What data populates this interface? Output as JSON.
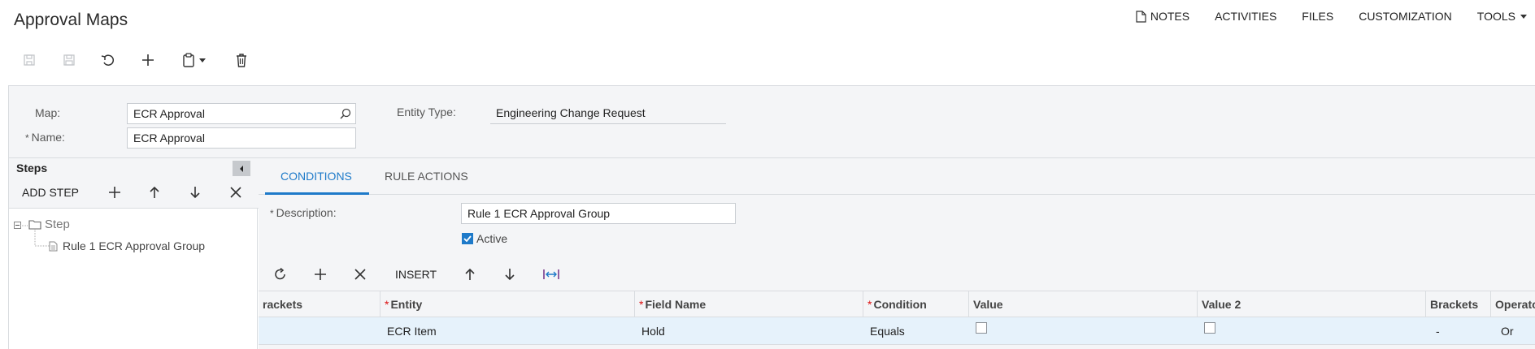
{
  "page": {
    "title": "Approval Maps"
  },
  "top_menu": {
    "notes": "NOTES",
    "activities": "ACTIVITIES",
    "files": "FILES",
    "customization": "CUSTOMIZATION",
    "tools": "TOOLS"
  },
  "form": {
    "map_label": "Map:",
    "map_value": "ECR Approval",
    "name_label": "Name:",
    "name_value": "ECR Approval",
    "entity_type_label": "Entity Type:",
    "entity_type_value": "Engineering Change Request",
    "required_mark": "*"
  },
  "steps": {
    "title": "Steps",
    "add_step_label": "ADD STEP",
    "tree": {
      "root_label": "Step",
      "child_label": "Rule 1 ECR Approval Group"
    }
  },
  "tabs": [
    {
      "label": "CONDITIONS",
      "active": true
    },
    {
      "label": "RULE ACTIONS",
      "active": false
    }
  ],
  "conditions": {
    "description_label": "Description:",
    "description_value": "Rule 1 ECR Approval Group",
    "active_label": "Active",
    "active_checked": true
  },
  "grid": {
    "insert_label": "INSERT",
    "columns": [
      {
        "label": "rackets",
        "required": false
      },
      {
        "label": "Entity",
        "required": true
      },
      {
        "label": "Field Name",
        "required": true
      },
      {
        "label": "Condition",
        "required": true
      },
      {
        "label": "Value",
        "required": false
      },
      {
        "label": "Value 2",
        "required": false
      },
      {
        "label": "Brackets",
        "required": false
      },
      {
        "label": "Operato",
        "required": false
      }
    ],
    "rows": [
      {
        "brackets_open": "",
        "entity": "ECR Item",
        "field_name": "Hold",
        "condition": "Equals",
        "value_checked": false,
        "value2_checked": false,
        "brackets_close": "-",
        "operator": "Or"
      }
    ]
  },
  "colors": {
    "accent": "#1e7ac9",
    "panel_bg": "#f4f5f7",
    "selected_row": "#e6f2fb",
    "required": "#dd1111"
  }
}
